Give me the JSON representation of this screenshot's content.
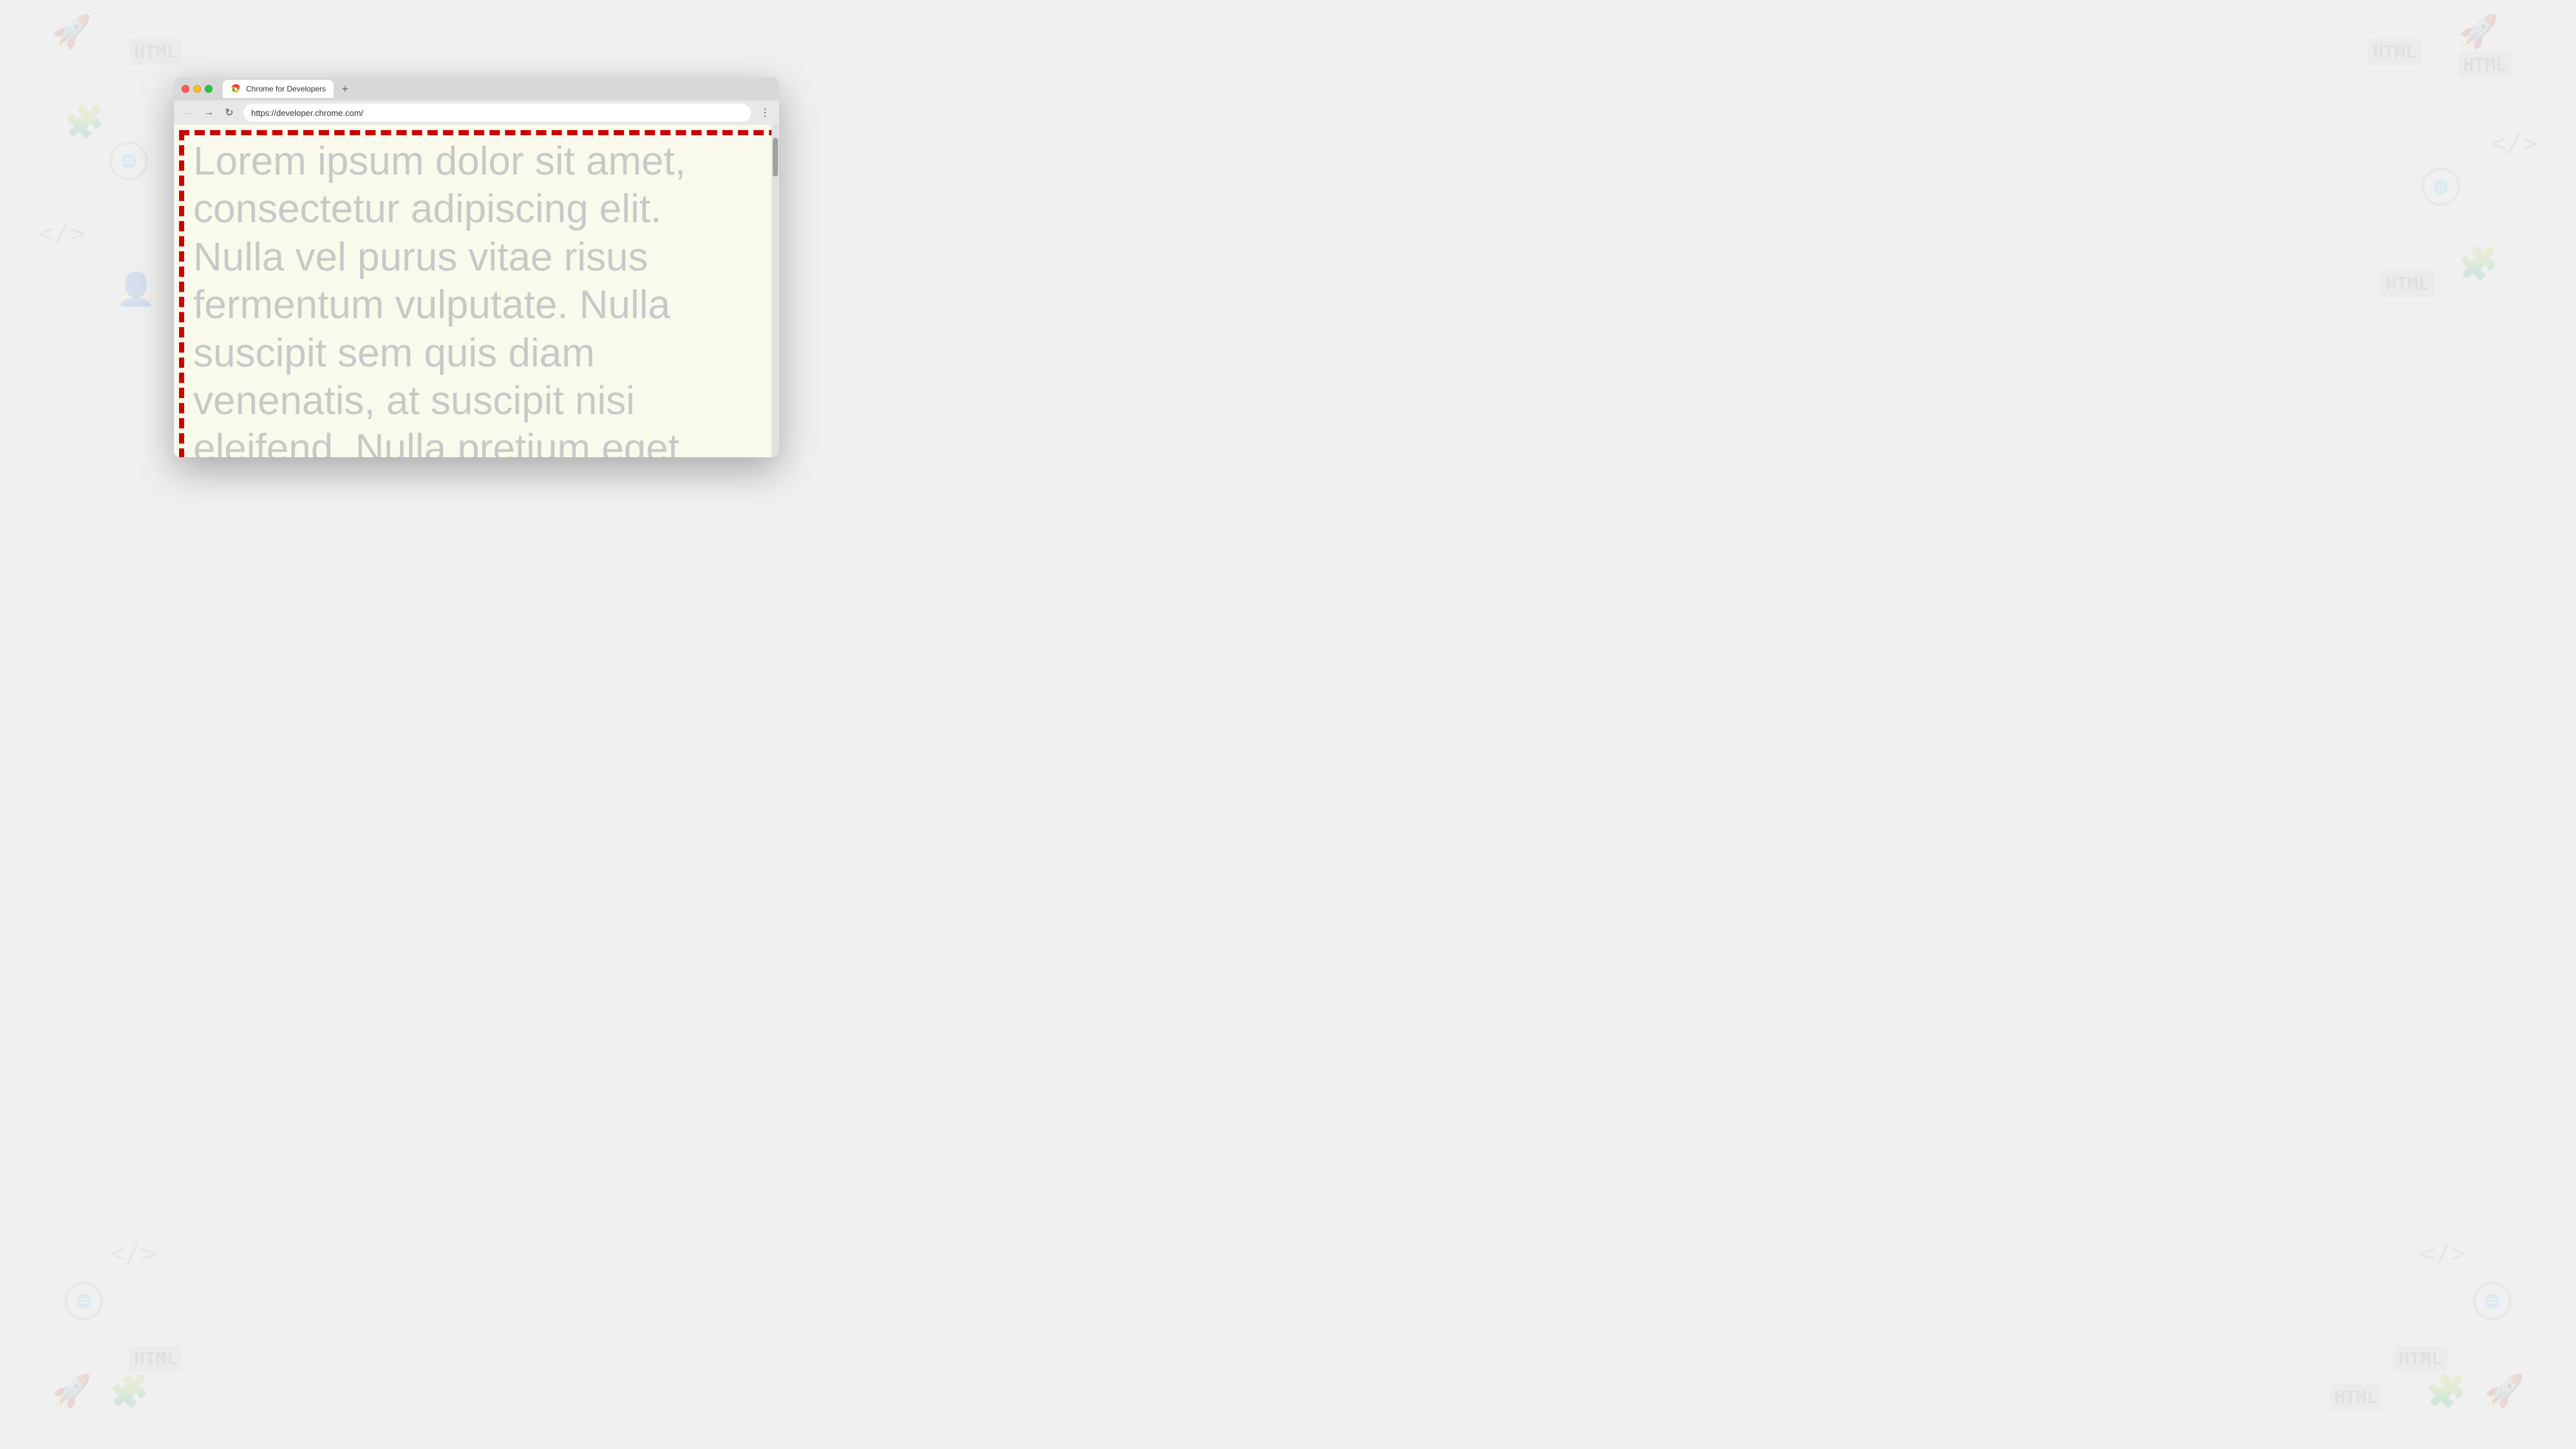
{
  "background": {
    "color": "#e0e0e0"
  },
  "browser": {
    "title_bar": {
      "tab_title": "Chrome for Developers",
      "tab_url": "https://developer.chrome.com/",
      "new_tab_label": "+"
    },
    "nav_bar": {
      "back_label": "←",
      "forward_label": "→",
      "refresh_label": "↻",
      "address": "https://developer.chrome.com/",
      "menu_label": "⋮"
    },
    "content": {
      "lorem_text": "Lorem ipsum dolor sit amet, consectetur adipiscing elit. Nulla vel purus vitae risus fermentum vulputate. Nulla suscipit sem quis diam venenatis, at suscipit nisi eleifend. Nulla pretium eget",
      "background_color": "#fafaec",
      "border_color": "#cc0000",
      "text_color": "#c8c8c8"
    }
  }
}
